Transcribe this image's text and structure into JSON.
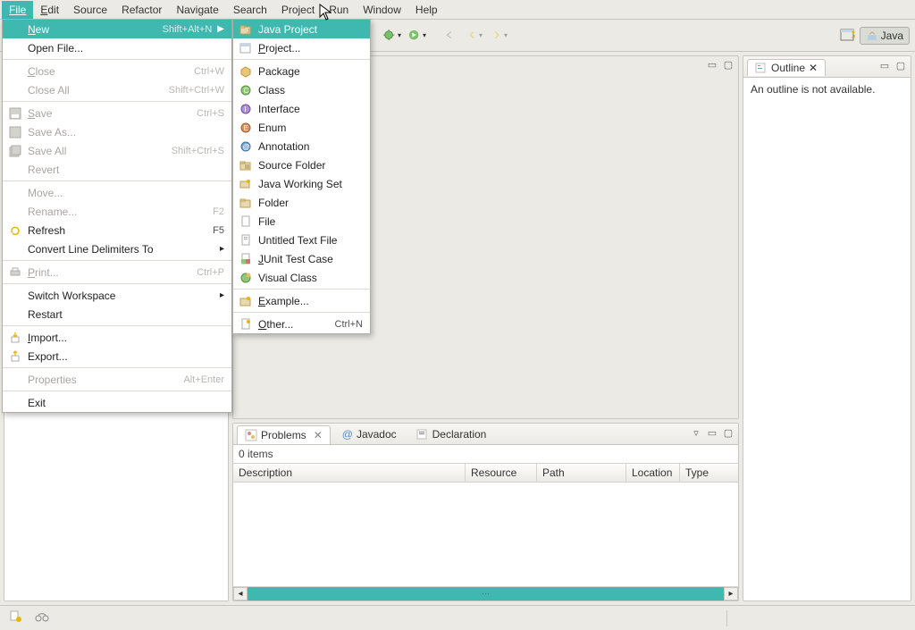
{
  "menubar": {
    "file": "File",
    "edit": "Edit",
    "source": "Source",
    "refactor": "Refactor",
    "navigate": "Navigate",
    "search": "Search",
    "project": "Project",
    "run": "Run",
    "window": "Window",
    "help": "Help"
  },
  "file_menu": {
    "new_label": "New",
    "new_accel": "Shift+Alt+N",
    "open_file": "Open File...",
    "close": "Close",
    "close_accel": "Ctrl+W",
    "close_all": "Close All",
    "close_all_accel": "Shift+Ctrl+W",
    "save": "Save",
    "save_accel": "Ctrl+S",
    "save_as": "Save As...",
    "save_all": "Save All",
    "save_all_accel": "Shift+Ctrl+S",
    "revert": "Revert",
    "move": "Move...",
    "rename": "Rename...",
    "rename_accel": "F2",
    "refresh": "Refresh",
    "refresh_accel": "F5",
    "convert_line": "Convert Line Delimiters To",
    "print": "Print...",
    "print_accel": "Ctrl+P",
    "switch_ws": "Switch Workspace",
    "restart": "Restart",
    "import": "Import...",
    "export": "Export...",
    "properties": "Properties",
    "properties_accel": "Alt+Enter",
    "exit": "Exit"
  },
  "new_menu": {
    "java_project": "Java Project",
    "project": "Project...",
    "package": "Package",
    "class": "Class",
    "interface": "Interface",
    "enum": "Enum",
    "annotation": "Annotation",
    "source_folder": "Source Folder",
    "java_working_set": "Java Working Set",
    "folder": "Folder",
    "file": "File",
    "untitled_text": "Untitled Text File",
    "junit_test": "JUnit Test Case",
    "visual_class": "Visual Class",
    "example": "Example...",
    "other": "Other...",
    "other_accel": "Ctrl+N"
  },
  "perspective": {
    "java": "Java"
  },
  "outline": {
    "title": "Outline",
    "empty": "An outline is not available."
  },
  "problems": {
    "tab_problems": "Problems",
    "tab_javadoc": "Javadoc",
    "tab_declaration": "Declaration",
    "items": "0 items",
    "cols": {
      "description": "Description",
      "resource": "Resource",
      "path": "Path",
      "location": "Location",
      "type": "Type"
    }
  }
}
